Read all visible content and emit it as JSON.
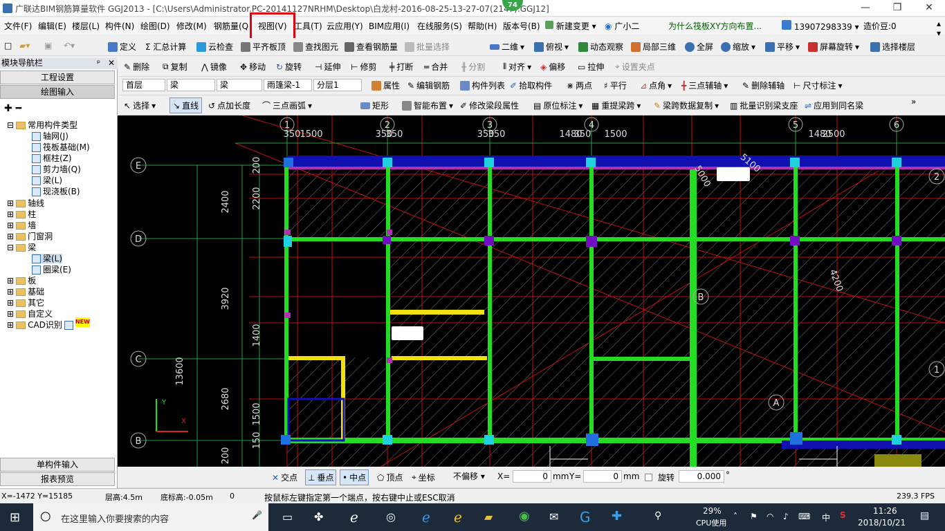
{
  "window": {
    "title": "广联达BIM钢筋算量软件 GGJ2013 - [C:\\Users\\Administrator.PC-20141127NRHM\\Desktop\\白龙村-2016-08-25-13-27-07(2147).GGJ12]",
    "badge": "74"
  },
  "menu": {
    "items": [
      "文件(F)",
      "编辑(E)",
      "楼层(L)",
      "构件(N)",
      "绘图(D)",
      "修改(M)",
      "钢筋量(Q)",
      "视图(V)",
      "工具(T)",
      "云应用(Y)",
      "BIM应用(I)",
      "在线服务(S)",
      "帮助(H)",
      "版本号(B)",
      "新建变更",
      "广小二",
      "为什么筏板XY方向布置...",
      "13907298339",
      "造价豆:0"
    ]
  },
  "toolbar1": {
    "items": [
      "定义",
      "Σ 汇总计算",
      "云检查",
      "平齐板顶",
      "查找图元",
      "查看钢筋量",
      "批量选择",
      "二维",
      "俯视",
      "动态观察",
      "局部三维",
      "全屏",
      "缩放",
      "平移",
      "屏幕旋转",
      "选择楼层"
    ]
  },
  "toolbar2": {
    "items": [
      "删除",
      "复制",
      "镜像",
      "移动",
      "旋转",
      "延伸",
      "修剪",
      "打断",
      "合并",
      "分割",
      "对齐",
      "偏移",
      "拉伸",
      "设置夹点"
    ]
  },
  "toolbar3": {
    "floor": "首层",
    "type1": "梁",
    "type2": "梁",
    "member": "雨篷梁-1",
    "layer": "分层1",
    "items": [
      "属性",
      "编辑钢筋",
      "构件列表",
      "拾取构件",
      "两点",
      "平行",
      "点角",
      "三点辅轴",
      "删除辅轴",
      "尺寸标注"
    ]
  },
  "toolbar4": {
    "items": [
      "选择",
      "直线",
      "点加长度",
      "三点画弧",
      "矩形",
      "智能布置",
      "修改梁段属性",
      "原位标注",
      "重提梁跨",
      "梁跨数据复制",
      "批量识别梁支座",
      "应用到同名梁"
    ]
  },
  "nav": {
    "title": "模块导航栏",
    "btn1": "工程设置",
    "btn2": "绘图输入",
    "btn3": "单构件输入",
    "btn4": "报表预览",
    "tree": [
      "常用构件类型",
      "轴网(J)",
      "筏板基础(M)",
      "框柱(Z)",
      "剪力墙(Q)",
      "梁(L)",
      "现浇板(B)",
      "轴线",
      "柱",
      "墙",
      "门窗洞",
      "梁",
      "梁(L)",
      "圈梁(E)",
      "板",
      "基础",
      "其它",
      "自定义",
      "CAD识别"
    ],
    "new_tag": "NEW"
  },
  "canvas": {
    "axis_top": [
      "1",
      "2",
      "3",
      "4",
      "5",
      "6"
    ],
    "axis_left": [
      "E",
      "D",
      "C",
      "B"
    ],
    "dims_top": [
      "350",
      "1500",
      "350",
      "350",
      "350",
      "350",
      "1480",
      "350",
      "1500",
      "1480",
      "2500"
    ],
    "dims_left": [
      "200",
      "2200",
      "2400",
      "3920",
      "1400",
      "13600",
      "2680",
      "1500",
      "150",
      "200"
    ],
    "tags": [
      "5100",
      "5000",
      "4200",
      "B",
      "A",
      "1",
      "2"
    ]
  },
  "snapbar": {
    "items": [
      "交点",
      "垂点",
      "中点",
      "顶点",
      "坐标",
      "不偏移",
      "X=",
      "0",
      "mm",
      "Y=",
      "0",
      "mm",
      "旋转",
      "0.000",
      "°"
    ]
  },
  "status": {
    "coords": "X=-1472 Y=15185",
    "floor_h": "层高:4.5m",
    "base_h": "底标高:-0.05m",
    "zero": "0",
    "hint": "按鼠标左键指定第一个端点，按右键中止或ESC取消",
    "fps": "239.3 FPS"
  },
  "taskbar": {
    "search": "在这里输入你要搜索的内容",
    "cpu": "29%",
    "cpu_label": "CPU使用",
    "ime": "中",
    "time": "11:26",
    "date": "2018/10/21"
  }
}
